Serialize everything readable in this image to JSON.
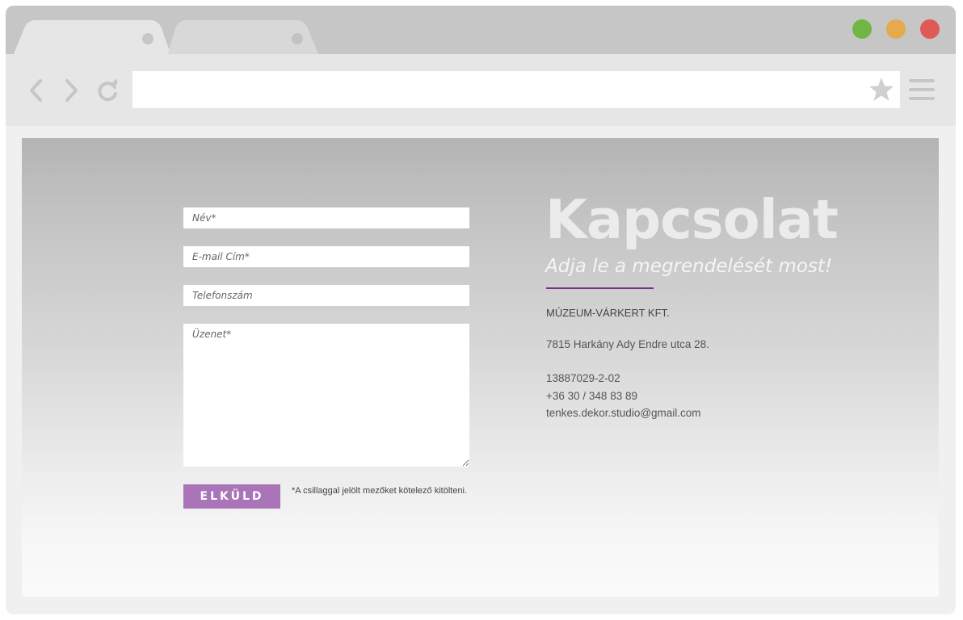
{
  "browser": {
    "window_buttons": [
      {
        "name": "maximize",
        "color": "#6fb644"
      },
      {
        "name": "minimize",
        "color": "#e6a94b"
      },
      {
        "name": "close",
        "color": "#df5a55"
      }
    ],
    "address_value": "",
    "icons": [
      "back-icon",
      "forward-icon",
      "reload-icon",
      "star-icon",
      "menu-icon"
    ]
  },
  "form": {
    "name_placeholder": "Név*",
    "email_placeholder": "E-mail Cím*",
    "phone_placeholder": "Telefonszám",
    "message_placeholder": "Üzenet*",
    "submit_label": "ELKÜLD",
    "required_note": "*A csillaggal jelölt mezőket kötelező kitölteni."
  },
  "contact": {
    "title": "Kapcsolat",
    "subtitle": "Adja le a megrendelését most!",
    "company": "MÚZEUM-VÁRKERT KFT.",
    "address": "7815 Harkány Ady Endre utca 28.",
    "tax_id": "13887029-2-02",
    "phone": "+36 30 / 348 83 89",
    "email": "tenkes.dekor.studio@gmail.com"
  },
  "colors": {
    "accent": "#a974b8",
    "accent_line": "#7a2f8c"
  }
}
